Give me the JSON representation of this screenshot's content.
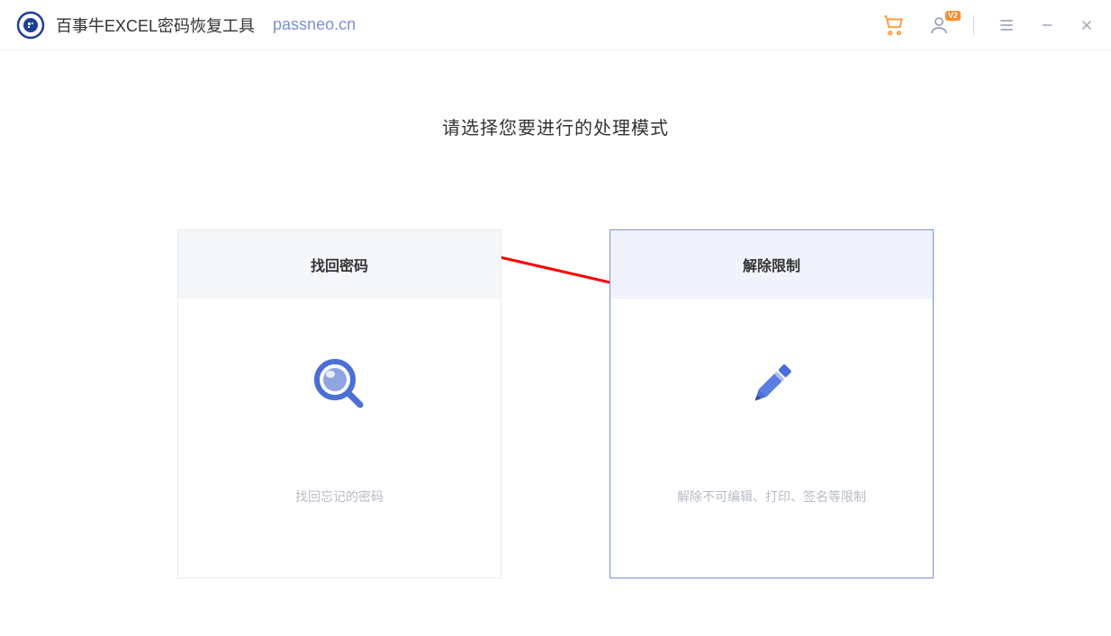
{
  "header": {
    "app_title": "百事牛EXCEL密码恢复工具",
    "website": "passneo.cn",
    "vip_badge": "V2"
  },
  "main": {
    "title": "请选择您要进行的处理模式",
    "cards": {
      "recover": {
        "title": "找回密码",
        "desc": "找回忘记的密码"
      },
      "unlock": {
        "title": "解除限制",
        "desc": "解除不可编辑、打印、签名等限制"
      }
    }
  }
}
